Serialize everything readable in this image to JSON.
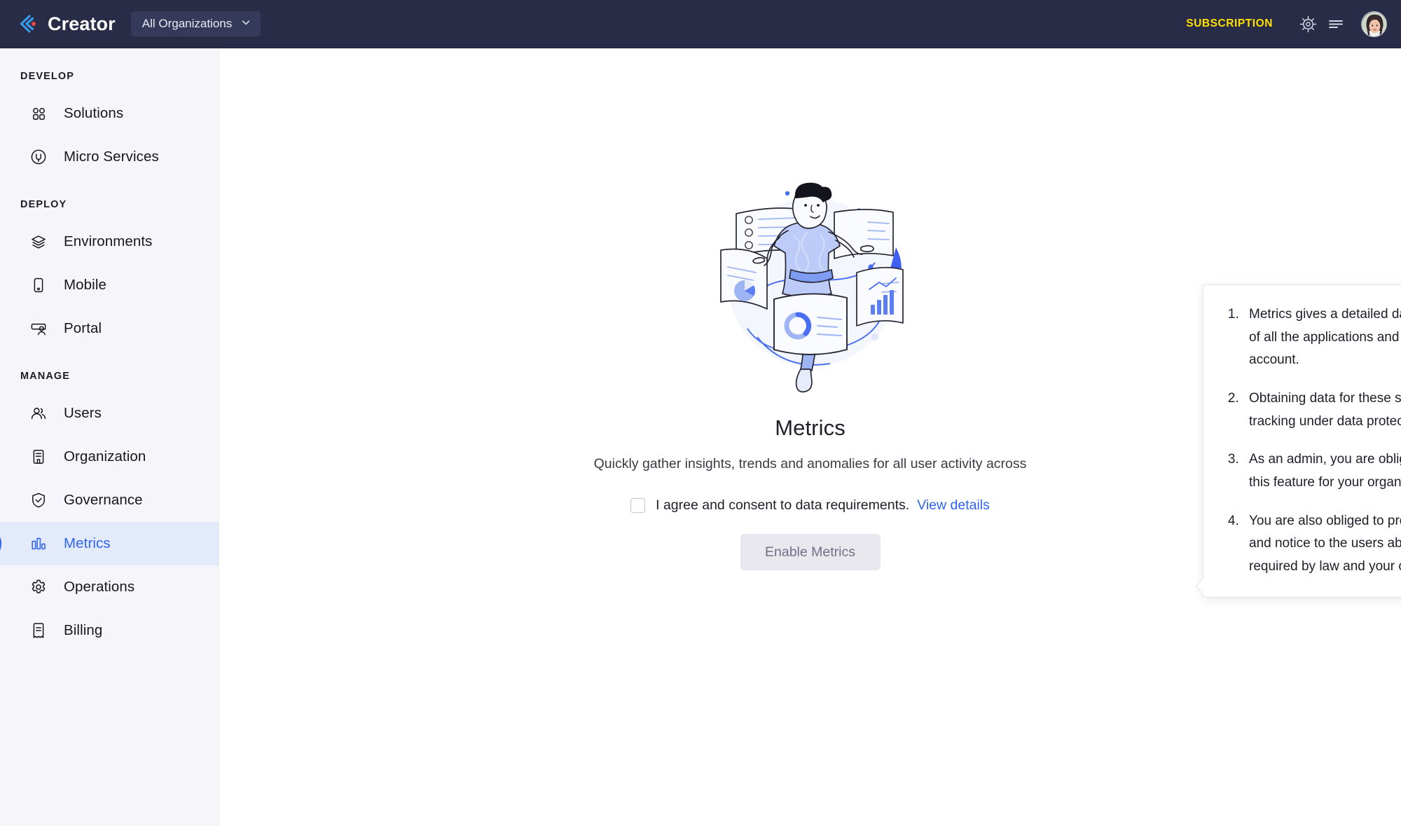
{
  "header": {
    "logo_icon": "creator-logo-icon",
    "brand": "Creator",
    "org_switcher": {
      "label": "All Organizations",
      "chevron_icon": "chevron-down-icon"
    },
    "subscription_label": "SUBSCRIPTION",
    "subscription_color": "#ffe000",
    "settings_icon": "gear-icon",
    "menu_icon": "hamburger-menu-icon",
    "avatar_icon": "user-avatar",
    "background_color": "#282c47"
  },
  "sidebar": {
    "background_color": "#f6f6fa",
    "active_color": "#2f63f5",
    "active_background": "#e3ebfb",
    "sections": [
      {
        "title": "DEVELOP",
        "items": [
          {
            "label": "Solutions",
            "icon": "grid-dots-icon",
            "active": false
          },
          {
            "label": "Micro Services",
            "icon": "plug-circle-icon",
            "active": false
          }
        ]
      },
      {
        "title": "DEPLOY",
        "items": [
          {
            "label": "Environments",
            "icon": "layers-icon",
            "active": false
          },
          {
            "label": "Mobile",
            "icon": "mobile-phone-icon",
            "active": false
          },
          {
            "label": "Portal",
            "icon": "portal-user-icon",
            "active": false
          }
        ]
      },
      {
        "title": "MANAGE",
        "items": [
          {
            "label": "Users",
            "icon": "users-icon",
            "active": false
          },
          {
            "label": "Organization",
            "icon": "building-icon",
            "active": false
          },
          {
            "label": "Governance",
            "icon": "shield-check-icon",
            "active": false
          },
          {
            "label": "Metrics",
            "icon": "bar-chart-icon",
            "active": true
          },
          {
            "label": "Operations",
            "icon": "gear-icon",
            "active": false
          },
          {
            "label": "Billing",
            "icon": "receipt-icon",
            "active": false
          }
        ]
      }
    ]
  },
  "main": {
    "illustration_icon": "metrics-dashboard-illustration",
    "title": "Metrics",
    "subtitle": "Quickly gather insights, trends and anomalies for all user activity across",
    "consent": {
      "checkbox_checked": false,
      "label": "I agree and consent to data requirements.",
      "view_details_label": "View details",
      "link_color": "#2f63f5"
    },
    "enable_button": {
      "label": "Enable Metrics",
      "disabled": true
    }
  },
  "popover": {
    "items": [
      "Metrics gives a detailed dashboard on usage statistics of all the applications and users in your Zoho Creator account.",
      "Obtaining data for these statistics may be construed as tracking under data protection laws.",
      "As an admin, you are obliged to check the lawful use of this feature for your organisation.",
      "You are also obliged to provide necessary transparency and notice to the users about this activity as may be required by law and your organizational policies."
    ]
  }
}
